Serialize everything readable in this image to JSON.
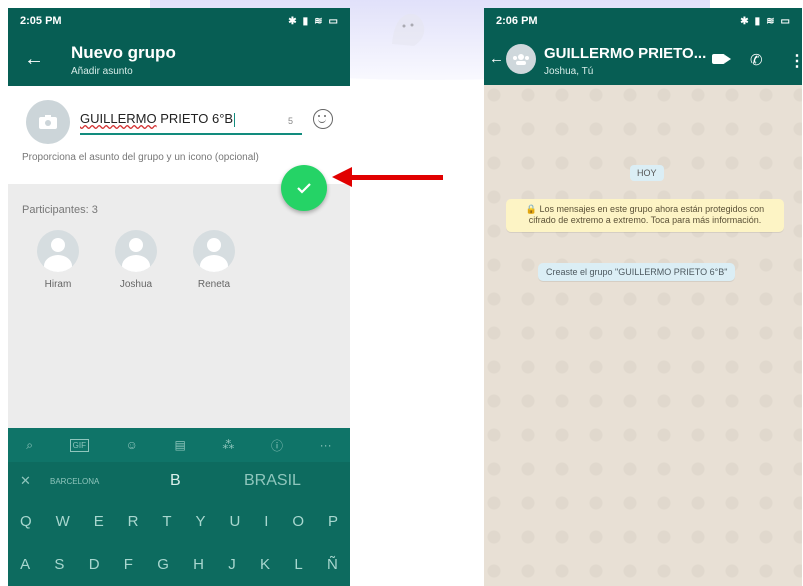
{
  "colors": {
    "header": "#075e54",
    "accent": "#128c7e",
    "fab": "#25d366",
    "arrow": "#e10000",
    "keyboard": "#0d6b5f"
  },
  "left_phone": {
    "status": {
      "time": "2:05 PM",
      "battery": "▭"
    },
    "header": {
      "title": "Nuevo grupo",
      "subtitle": "Añadir asunto"
    },
    "group_name": {
      "word1": "GUILLERMO",
      "rest": " PRIETO 6°B",
      "char_count": "5"
    },
    "hint": "Proporciona el asunto del grupo y un icono (opcional)",
    "participants_label": "Participantes: 3",
    "participants": [
      {
        "name": "Hiram"
      },
      {
        "name": "Joshua"
      },
      {
        "name": "Reneta"
      }
    ],
    "keyboard": {
      "tools": [
        "⌕",
        "GIF",
        "☺",
        "▤",
        "⁂",
        "ⓘ",
        "···"
      ],
      "suggestions": [
        "BARCELONA",
        "B",
        "BRASIL"
      ],
      "row1": [
        "Q",
        "W",
        "E",
        "R",
        "T",
        "Y",
        "U",
        "I",
        "O",
        "P"
      ],
      "row2": [
        "A",
        "S",
        "D",
        "F",
        "G",
        "H",
        "J",
        "K",
        "L",
        "Ñ"
      ]
    }
  },
  "right_phone": {
    "status": {
      "time": "2:06 PM"
    },
    "header": {
      "title": "GUILLERMO PRIETO...",
      "subtitle": "Joshua, Tú"
    },
    "date_chip": "HOY",
    "encryption_notice": "🔒 Los mensajes en este grupo ahora están protegidos con cifrado de extremo a extremo. Toca para más información.",
    "created_message": "Creaste el grupo \"GUILLERMO PRIETO 6°B\""
  }
}
